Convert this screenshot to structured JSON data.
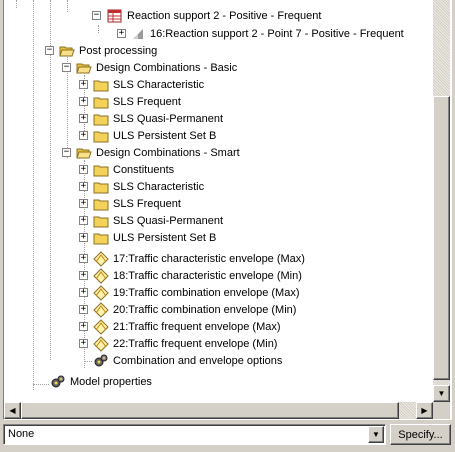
{
  "tree": {
    "nodes": [
      {
        "label": "Reaction support 2 - Positive - Frequent",
        "icon": "table-icon",
        "expander": "minus"
      },
      {
        "label": "16:Reaction support 2 - Point 7 - Positive - Frequent",
        "icon": "result-icon",
        "expander": "plus"
      },
      {
        "label": "Post processing",
        "icon": "folder-open-icon",
        "expander": "minus"
      },
      {
        "label": "Design Combinations - Basic",
        "icon": "folder-open-icon",
        "expander": "minus"
      },
      {
        "label": "SLS Characteristic",
        "icon": "folder-icon",
        "expander": "plus"
      },
      {
        "label": "SLS Frequent",
        "icon": "folder-icon",
        "expander": "plus"
      },
      {
        "label": "SLS Quasi-Permanent",
        "icon": "folder-icon",
        "expander": "plus"
      },
      {
        "label": "ULS Persistent Set B",
        "icon": "folder-icon",
        "expander": "plus"
      },
      {
        "label": "Design Combinations - Smart",
        "icon": "folder-open-icon",
        "expander": "minus"
      },
      {
        "label": "Constituents",
        "icon": "folder-icon",
        "expander": "plus"
      },
      {
        "label": "SLS Characteristic",
        "icon": "folder-icon",
        "expander": "plus"
      },
      {
        "label": "SLS Frequent",
        "icon": "folder-icon",
        "expander": "plus"
      },
      {
        "label": "SLS Quasi-Permanent",
        "icon": "folder-icon",
        "expander": "plus"
      },
      {
        "label": "ULS Persistent Set B",
        "icon": "folder-icon",
        "expander": "plus"
      },
      {
        "label": "17:Traffic characteristic envelope (Max)",
        "icon": "envelope-icon",
        "expander": "plus"
      },
      {
        "label": "18:Traffic characteristic envelope (Min)",
        "icon": "envelope-icon",
        "expander": "plus"
      },
      {
        "label": "19:Traffic combination envelope (Max)",
        "icon": "envelope-icon",
        "expander": "plus"
      },
      {
        "label": "20:Traffic combination envelope (Min)",
        "icon": "envelope-icon",
        "expander": "plus"
      },
      {
        "label": "21:Traffic frequent envelope (Max)",
        "icon": "envelope-icon",
        "expander": "plus"
      },
      {
        "label": "22:Traffic frequent envelope (Min)",
        "icon": "envelope-icon",
        "expander": "plus"
      },
      {
        "label": "Combination and envelope options",
        "icon": "gears-icon",
        "expander": "none"
      },
      {
        "label": "Model properties",
        "icon": "gears-icon",
        "expander": "none"
      }
    ]
  },
  "bottom_bar": {
    "combo_value": "None",
    "specify_label": "Specify..."
  },
  "colors": {
    "folder": "#f4d25a",
    "window_bg": "#d4d0c8",
    "tree_bg": "#ffffff"
  }
}
